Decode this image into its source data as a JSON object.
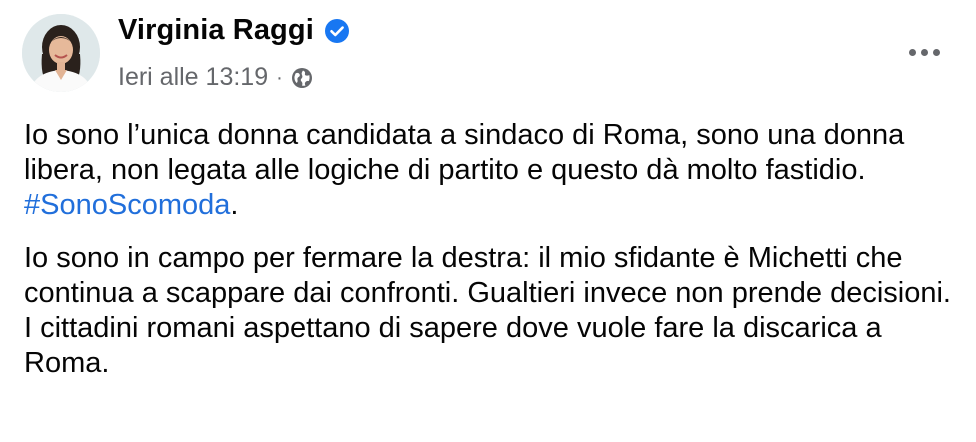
{
  "author": {
    "name": "Virginia Raggi",
    "verified": true
  },
  "post_meta": {
    "timestamp": "Ieri alle 13:19",
    "separator": "·",
    "audience_icon": "globe-icon"
  },
  "more_icon": "more-options-icon",
  "content": {
    "paragraph1_text": "Io sono l’unica donna candidata a sindaco di Roma, sono una donna libera, non legata alle logiche di partito e questo dà molto fastidio. ",
    "paragraph1_hashtag": "#SonoScomoda",
    "paragraph1_end": ".",
    "paragraph2_text": "Io sono in campo per fermare la destra: il mio sfidante è Michetti che continua a scappare dai confronti. Gualtieri invece non prende decisioni. I cittadini romani aspettano di sapere dove vuole fare la discarica a Roma."
  },
  "colors": {
    "hashtag": "#216fdb",
    "verified_badge": "#1877f2",
    "secondary_text": "#65676b"
  }
}
